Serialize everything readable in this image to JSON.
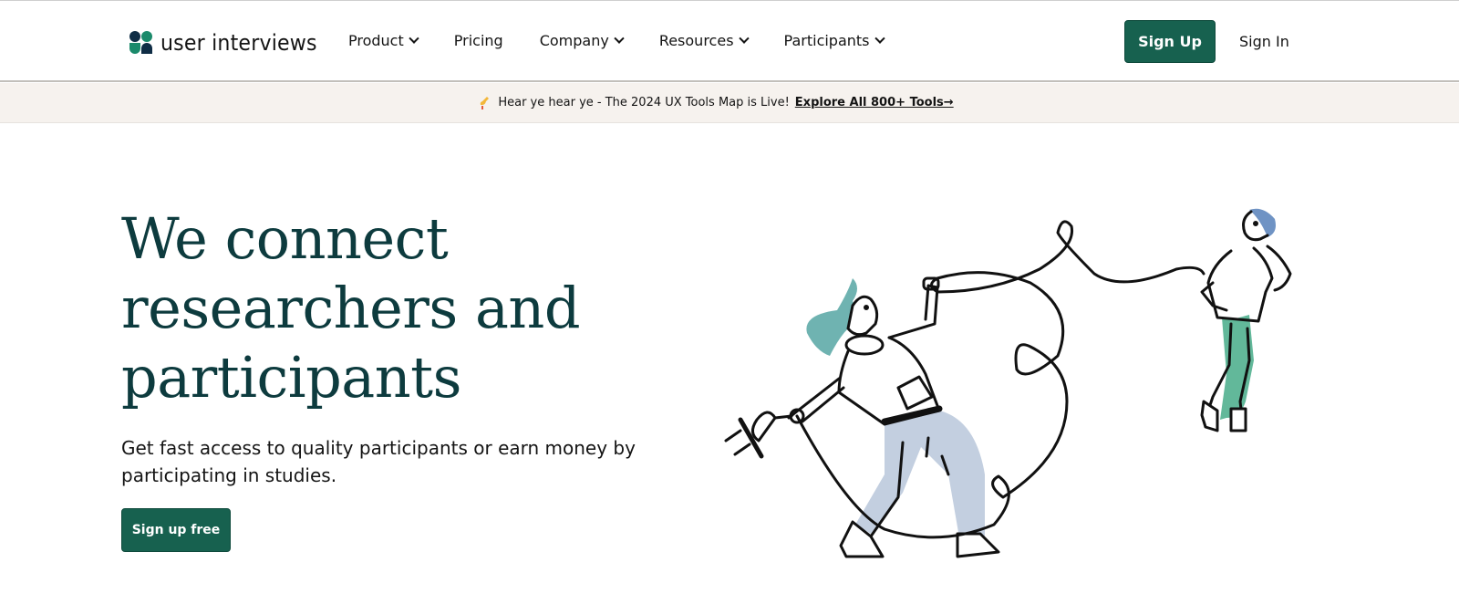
{
  "brand": {
    "name": "user interviews",
    "colors": {
      "primary_green": "#17614f",
      "heading_teal": "#0d3b3e",
      "logo_navy": "#0f2d45",
      "logo_green": "#1b8a6b",
      "banner_bg": "#f6f2ee",
      "hair_teal": "#6fb3b1",
      "pants_blue": "#c3cfe0",
      "pants_green": "#62b89a",
      "hair_blue": "#6f93c4"
    }
  },
  "nav": {
    "items": [
      {
        "label": "Product",
        "has_dropdown": true
      },
      {
        "label": "Pricing",
        "has_dropdown": false
      },
      {
        "label": "Company",
        "has_dropdown": true
      },
      {
        "label": "Resources",
        "has_dropdown": true
      },
      {
        "label": "Participants",
        "has_dropdown": true
      }
    ],
    "signup_label": "Sign Up",
    "signin_label": "Sign In"
  },
  "banner": {
    "icon": "trumpet-icon",
    "text": "Hear ye hear ye - The 2024 UX Tools Map is Live!",
    "link_label": "Explore All 800+ Tools→"
  },
  "hero": {
    "title_lines": [
      "We connect",
      "researchers and",
      "participants"
    ],
    "subtitle": "Get fast access to quality participants or earn money by participating in studies.",
    "cta_label": "Sign up free"
  }
}
